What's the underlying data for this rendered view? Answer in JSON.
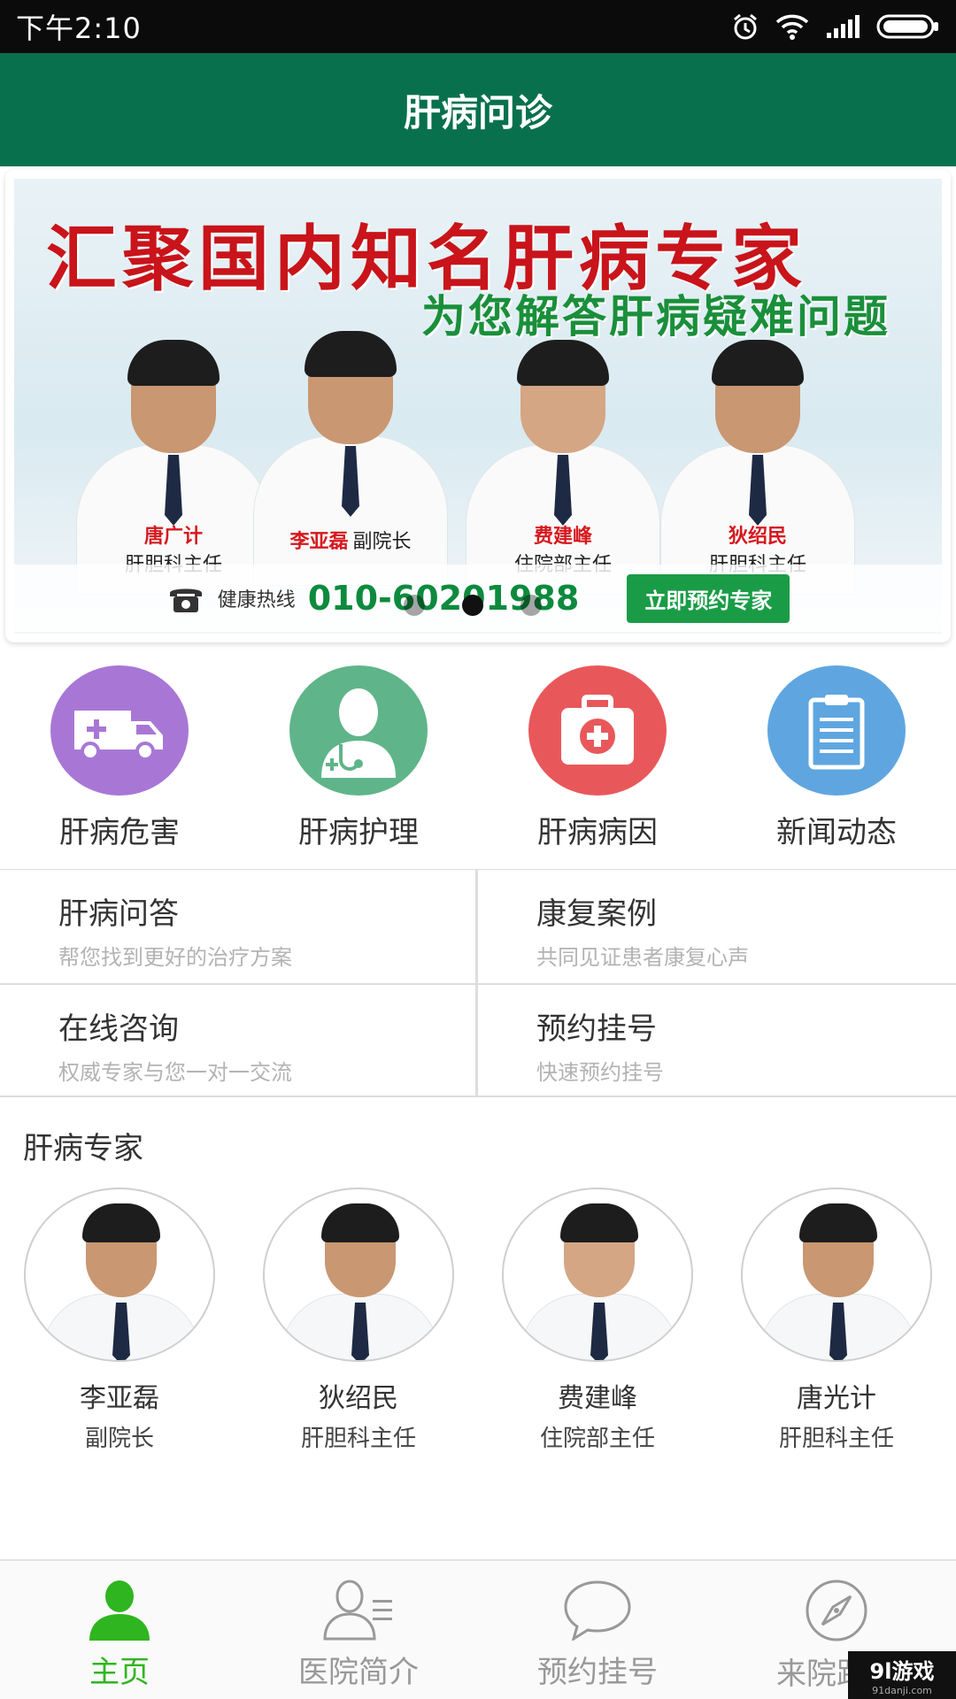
{
  "status_bar": {
    "time": "下午2:10"
  },
  "header": {
    "title": "肝病问诊"
  },
  "banner": {
    "headline": "汇聚国内知名肝病专家",
    "subheadline": "为您解答肝病疑难问题",
    "doctors": [
      {
        "name": "唐广计",
        "title": "肝胆科主任"
      },
      {
        "name": "李亚磊",
        "title": "副院长"
      },
      {
        "name": "费建峰",
        "title": "住院部主任"
      },
      {
        "name": "狄绍民",
        "title": "肝胆科主任"
      }
    ],
    "hotline_label": "健康热线",
    "hotline_number": "010-60201988",
    "cta": "立即预约专家",
    "active_slide": 2,
    "slide_count": 3
  },
  "quick_links": [
    {
      "label": "肝病危害",
      "icon": "ambulance-icon",
      "color": "#a877d6"
    },
    {
      "label": "肝病护理",
      "icon": "doctor-icon",
      "color": "#5fb589"
    },
    {
      "label": "肝病病因",
      "icon": "medical-kit-icon",
      "color": "#e8585b"
    },
    {
      "label": "新闻动态",
      "icon": "clipboard-icon",
      "color": "#5fa6e0"
    }
  ],
  "grid": [
    {
      "title": "肝病问答",
      "subtitle": "帮您找到更好的治疗方案"
    },
    {
      "title": "康复案例",
      "subtitle": "共同见证患者康复心声"
    },
    {
      "title": "在线咨询",
      "subtitle": "权威专家与您一对一交流"
    },
    {
      "title": "预约挂号",
      "subtitle": "快速预约挂号"
    }
  ],
  "experts_section": {
    "title": "肝病专家",
    "experts": [
      {
        "name": "李亚磊",
        "title": "副院长"
      },
      {
        "name": "狄绍民",
        "title": "肝胆科主任"
      },
      {
        "name": "费建峰",
        "title": "住院部主任"
      },
      {
        "name": "唐光计",
        "title": "肝胆科主任"
      }
    ]
  },
  "tabbar": [
    {
      "label": "主页",
      "icon": "person-icon",
      "active": true
    },
    {
      "label": "医院简介",
      "icon": "profile-list-icon",
      "active": false
    },
    {
      "label": "预约挂号",
      "icon": "chat-bubble-icon",
      "active": false
    },
    {
      "label": "来院路线",
      "icon": "compass-icon",
      "active": false
    }
  ],
  "watermark": {
    "logo": "9l游戏",
    "url": "91danji.com"
  },
  "colors": {
    "header": "#09704d",
    "tab_active": "#2fb51f"
  }
}
